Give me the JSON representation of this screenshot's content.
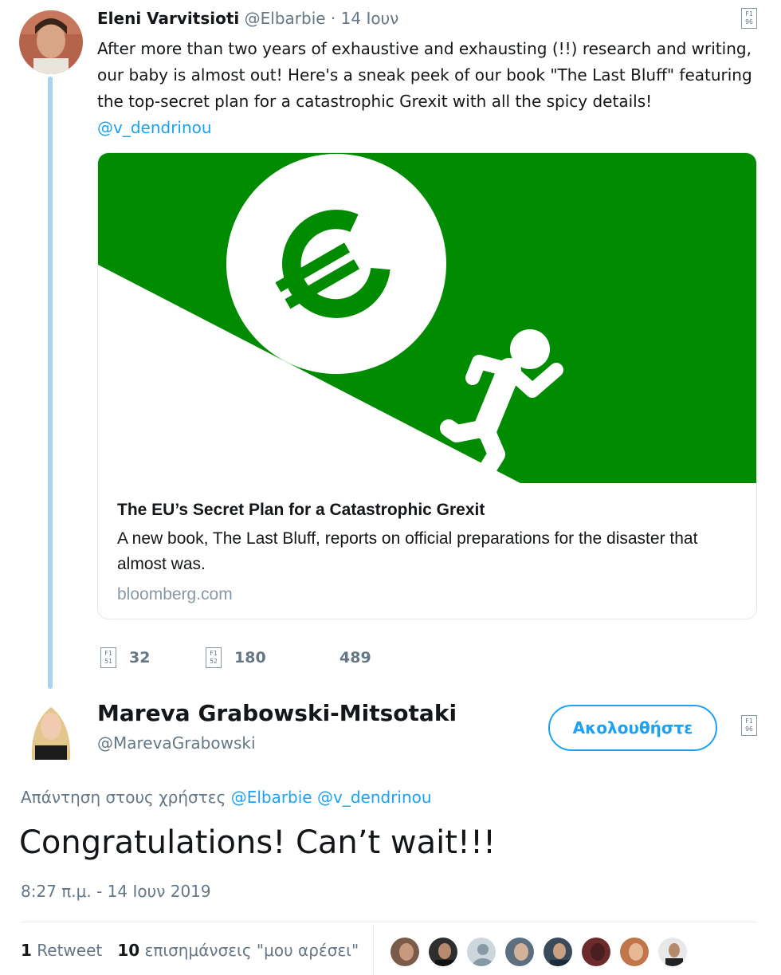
{
  "tweet1": {
    "name": "Eleni Varvitsioti",
    "handle": "@Elbarbie",
    "date": "· 14 Ιουν",
    "text_line1": "After more than two years of exhaustive and exhausting (!!) research and writing,",
    "text_line2": "our baby is almost out! Here's a sneak peek of our book \"The Last Bluff\"  featuring",
    "text_line3": "the top-secret plan for a catastrophic Grexit with all the spicy details!",
    "mention": "@v_dendrinou",
    "card": {
      "title": "The EU’s Secret Plan for a Catastrophic Grexit",
      "description": "A new book, The Last Bluff, reports on official preparations for the disaster that almost was.",
      "domain": "bloomberg.com"
    },
    "actions": {
      "reply_count": "32",
      "retweet_count": "180",
      "like_count": "489"
    }
  },
  "tweet2": {
    "name": "Mareva Grabowski-Mitsotaki",
    "handle": "@MarevaGrabowski",
    "follow_label": "Ακολουθήστε",
    "reply_prefix": "Απάντηση στους χρήστες",
    "reply_mention1": "@Elbarbie",
    "reply_mention2": "@v_dendrinou",
    "text": "Congratulations! Can’t wait!!!",
    "timestamp": "8:27 π.μ. - 14 Ιουν 2019",
    "retweet_count": "1",
    "retweet_label": "Retweet",
    "like_count": "10",
    "like_label": "επισημάνσεις \"μου αρέσει\""
  },
  "colors": {
    "accent": "#1da1f2",
    "card_green": "#008b00",
    "thread_line": "#a8d3f0",
    "secondary_text": "#657786"
  },
  "icons": {
    "caret": "chevron-down-icon",
    "reply": "reply-icon",
    "retweet": "retweet-icon",
    "like": "heart-icon"
  }
}
